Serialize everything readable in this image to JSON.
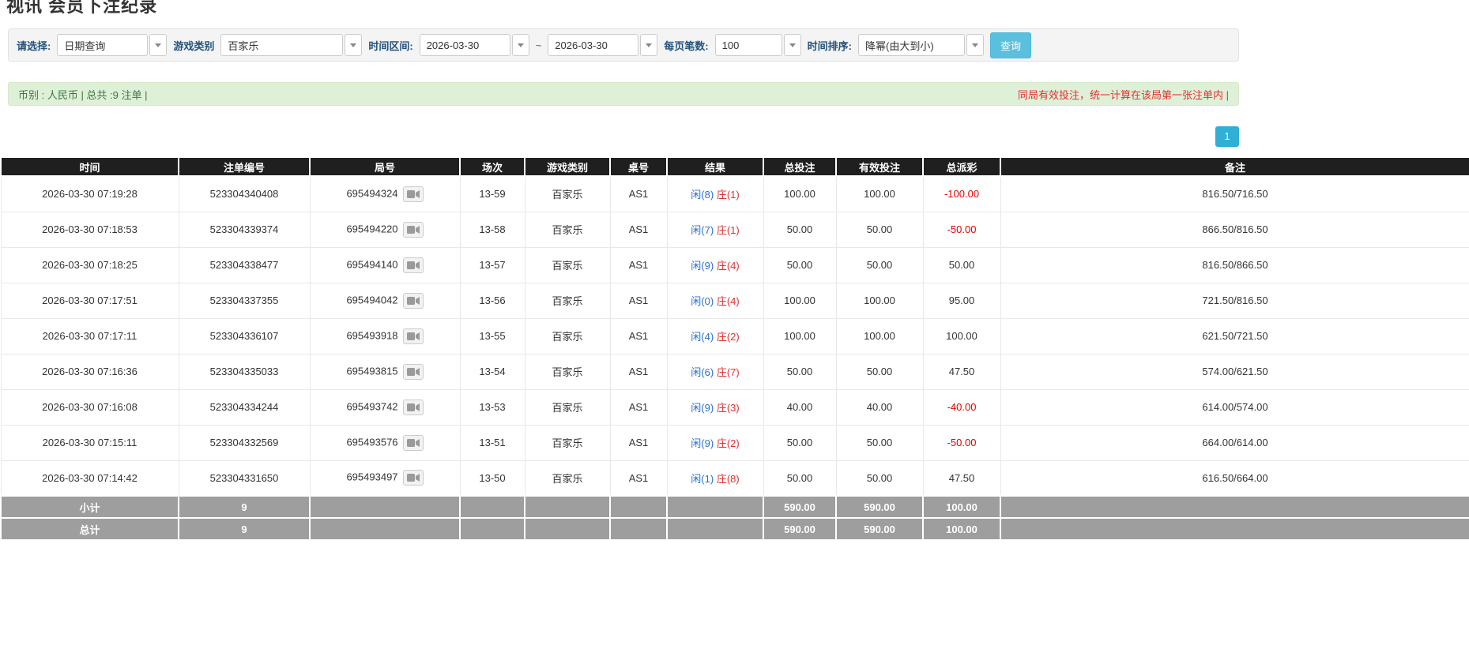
{
  "page": {
    "title": "视讯 会员下注纪录"
  },
  "colors": {
    "accent_cyan": "#5bc0de",
    "link_blue": "#337ab7",
    "player_blue": "#2a6fd1",
    "banker_red": "#e03131",
    "negative_red": "#e60000",
    "header_dark": "#1f1f1f",
    "footer_gray": "#9e9e9e",
    "summary_green": "#dff0d8"
  },
  "filters": {
    "select_label": "请选择:",
    "select_value": "日期查询",
    "game_type_label": "游戏类别",
    "game_type_value": "百家乐",
    "date_range_label": "时间区间:",
    "date_from": "2026-03-30",
    "range_separator": "~",
    "date_to": "2026-03-30",
    "page_size_label": "每页笔数:",
    "page_size_value": "100",
    "sort_label": "时间排序:",
    "sort_value": "降幂(由大到小)",
    "search_button": "查询"
  },
  "summary": {
    "left_text": "币别 : 人民币 | 总共 :9 注单 |",
    "right_text": "同局有效投注，统一计算在该局第一张注单内 |"
  },
  "pagination": {
    "current_page": "1"
  },
  "table": {
    "headers": [
      "时间",
      "注单编号",
      "局号",
      "场次",
      "游戏类别",
      "桌号",
      "结果",
      "总投注",
      "有效投注",
      "总派彩",
      "备注"
    ],
    "rows": [
      {
        "time": "2026-03-30 07:19:28",
        "bet_id": "523304340408",
        "round_id": "695494324",
        "session": "13-59",
        "game": "百家乐",
        "table_no": "AS1",
        "player": "闲(8)",
        "banker": "庄(1)",
        "total_bet": "100.00",
        "valid_bet": "100.00",
        "payout": "-100.00",
        "remark": "816.50/716.50"
      },
      {
        "time": "2026-03-30 07:18:53",
        "bet_id": "523304339374",
        "round_id": "695494220",
        "session": "13-58",
        "game": "百家乐",
        "table_no": "AS1",
        "player": "闲(7)",
        "banker": "庄(1)",
        "total_bet": "50.00",
        "valid_bet": "50.00",
        "payout": "-50.00",
        "remark": "866.50/816.50"
      },
      {
        "time": "2026-03-30 07:18:25",
        "bet_id": "523304338477",
        "round_id": "695494140",
        "session": "13-57",
        "game": "百家乐",
        "table_no": "AS1",
        "player": "闲(9)",
        "banker": "庄(4)",
        "total_bet": "50.00",
        "valid_bet": "50.00",
        "payout": "50.00",
        "remark": "816.50/866.50"
      },
      {
        "time": "2026-03-30 07:17:51",
        "bet_id": "523304337355",
        "round_id": "695494042",
        "session": "13-56",
        "game": "百家乐",
        "table_no": "AS1",
        "player": "闲(0)",
        "banker": "庄(4)",
        "total_bet": "100.00",
        "valid_bet": "100.00",
        "payout": "95.00",
        "remark": "721.50/816.50"
      },
      {
        "time": "2026-03-30 07:17:11",
        "bet_id": "523304336107",
        "round_id": "695493918",
        "session": "13-55",
        "game": "百家乐",
        "table_no": "AS1",
        "player": "闲(4)",
        "banker": "庄(2)",
        "total_bet": "100.00",
        "valid_bet": "100.00",
        "payout": "100.00",
        "remark": "621.50/721.50"
      },
      {
        "time": "2026-03-30 07:16:36",
        "bet_id": "523304335033",
        "round_id": "695493815",
        "session": "13-54",
        "game": "百家乐",
        "table_no": "AS1",
        "player": "闲(6)",
        "banker": "庄(7)",
        "total_bet": "50.00",
        "valid_bet": "50.00",
        "payout": "47.50",
        "remark": "574.00/621.50"
      },
      {
        "time": "2026-03-30 07:16:08",
        "bet_id": "523304334244",
        "round_id": "695493742",
        "session": "13-53",
        "game": "百家乐",
        "table_no": "AS1",
        "player": "闲(9)",
        "banker": "庄(3)",
        "total_bet": "40.00",
        "valid_bet": "40.00",
        "payout": "-40.00",
        "remark": "614.00/574.00"
      },
      {
        "time": "2026-03-30 07:15:11",
        "bet_id": "523304332569",
        "round_id": "695493576",
        "session": "13-51",
        "game": "百家乐",
        "table_no": "AS1",
        "player": "闲(9)",
        "banker": "庄(2)",
        "total_bet": "50.00",
        "valid_bet": "50.00",
        "payout": "-50.00",
        "remark": "664.00/614.00"
      },
      {
        "time": "2026-03-30 07:14:42",
        "bet_id": "523304331650",
        "round_id": "695493497",
        "session": "13-50",
        "game": "百家乐",
        "table_no": "AS1",
        "player": "闲(1)",
        "banker": "庄(8)",
        "total_bet": "50.00",
        "valid_bet": "50.00",
        "payout": "47.50",
        "remark": "616.50/664.00"
      }
    ],
    "subtotal": {
      "label": "小计",
      "count": "9",
      "total_bet": "590.00",
      "valid_bet": "590.00",
      "payout": "100.00"
    },
    "total": {
      "label": "总计",
      "count": "9",
      "total_bet": "590.00",
      "valid_bet": "590.00",
      "payout": "100.00"
    }
  }
}
